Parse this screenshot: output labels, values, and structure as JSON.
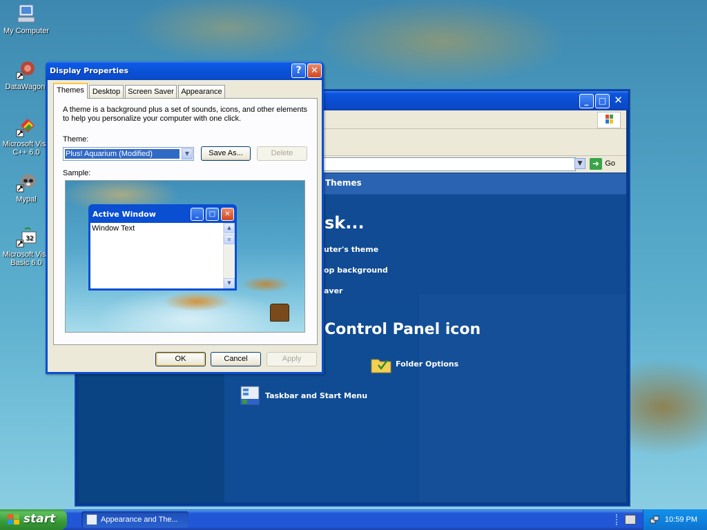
{
  "desktop": {
    "icons": [
      {
        "label": "My Computer"
      },
      {
        "label": "DataWagon."
      },
      {
        "label": "Microsoft Visu C++ 6.0"
      },
      {
        "label": "Mypal"
      },
      {
        "label": "Microsoft Visu Basic 6.0"
      }
    ]
  },
  "control_panel": {
    "address_go": "Go",
    "header": "Themes",
    "heading_pick_task": "sk...",
    "tasks": [
      "uter's theme",
      "op background",
      "aver"
    ],
    "heading_pick_icon": "Control Panel icon",
    "icons": [
      "Folder Options",
      "Taskbar and Start Menu"
    ]
  },
  "dialog": {
    "title": "Display Properties",
    "help_glyph": "?",
    "tabs": [
      "Themes",
      "Desktop",
      "Screen Saver",
      "Appearance"
    ],
    "description": "A theme is a background plus a set of sounds, icons, and other elements to help you personalize your computer with one click.",
    "theme_label": "Theme:",
    "theme_value": "Plus! Aquarium (Modified)",
    "save_as": "Save As...",
    "delete": "Delete",
    "sample_label": "Sample:",
    "sample_window": {
      "title": "Active Window",
      "text": "Window Text"
    },
    "ok": "OK",
    "cancel": "Cancel",
    "apply": "Apply"
  },
  "taskbar": {
    "start": "start",
    "task": "Appearance and The...",
    "clock": "10:59 PM"
  }
}
